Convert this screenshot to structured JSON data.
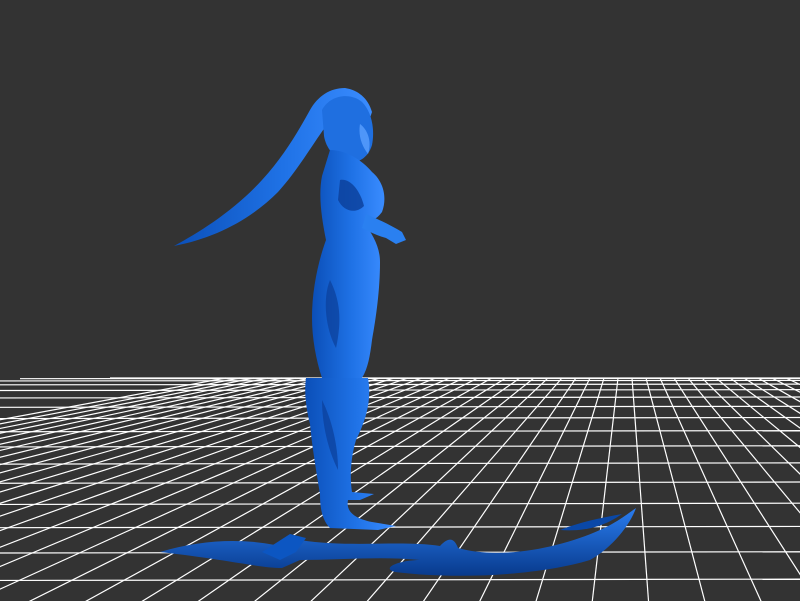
{
  "viewer": {
    "background_color": "#333333",
    "grid_color": "#ffffff",
    "model_color": "#1f6fe0",
    "model_shadow_color": "#0b3f99",
    "model_highlight_color": "#4f97ff"
  }
}
